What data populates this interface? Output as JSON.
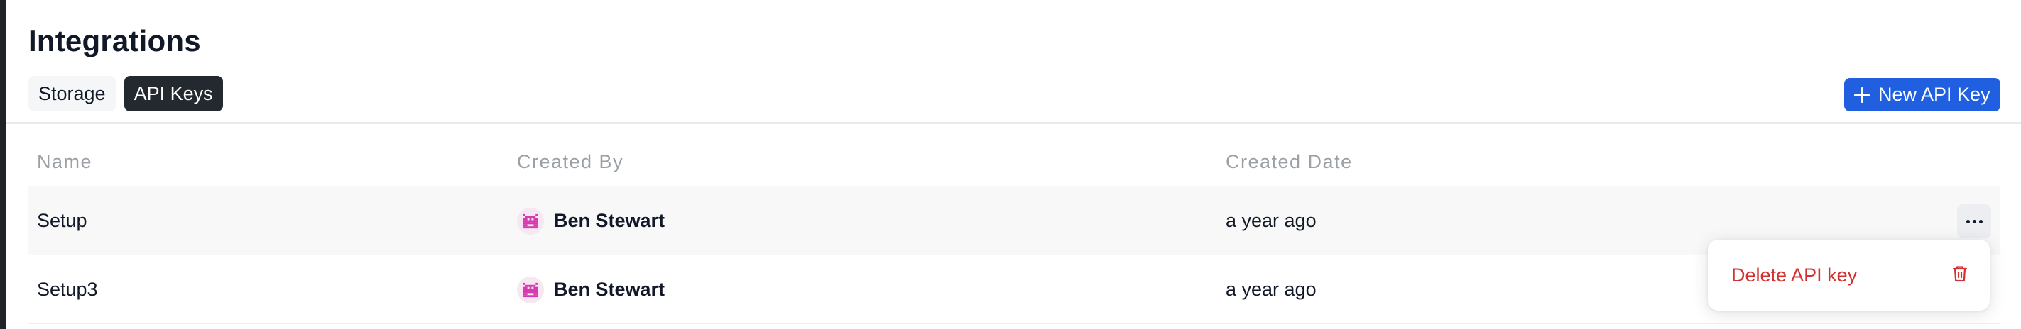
{
  "page": {
    "title": "Integrations"
  },
  "tabs": [
    {
      "label": "Storage",
      "active": false
    },
    {
      "label": "API Keys",
      "active": true
    }
  ],
  "toolbar": {
    "new_key_label": "New API Key",
    "new_key_icon": "plus-icon"
  },
  "table": {
    "columns": [
      "Name",
      "Created By",
      "Created Date"
    ],
    "rows": [
      {
        "name": "Setup",
        "created_by": "Ben Stewart",
        "created_date": "a year ago",
        "actions_icon": "more-horizontal-icon"
      },
      {
        "name": "Setup3",
        "created_by": "Ben Stewart",
        "created_date": "a year ago"
      }
    ]
  },
  "menu": {
    "delete_label": "Delete API key",
    "delete_icon": "trash-icon"
  },
  "colors": {
    "primary": "#1f5fe0",
    "active_tab": "#24292f",
    "danger": "#d03232",
    "avatar": "#d63ab0"
  }
}
